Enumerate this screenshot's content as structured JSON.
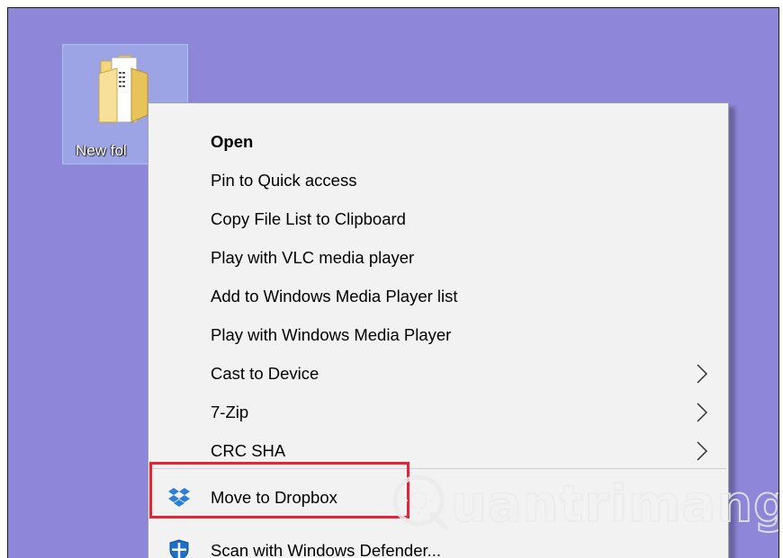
{
  "desktop": {
    "background_color": "#8e86d8",
    "folder": {
      "label": "New fol",
      "icon": "folder-icon"
    }
  },
  "context_menu": {
    "items": [
      {
        "label": "Open",
        "bold": true
      },
      {
        "label": "Pin to Quick access"
      },
      {
        "label": "Copy File List to Clipboard"
      },
      {
        "label": "Play with VLC media player"
      },
      {
        "label": "Add to Windows Media Player list"
      },
      {
        "label": "Play with Windows Media Player"
      },
      {
        "label": "Cast to Device",
        "submenu": true
      },
      {
        "label": "7-Zip",
        "submenu": true
      },
      {
        "label": "CRC SHA",
        "submenu": true
      },
      {
        "label": "Move to Dropbox",
        "icon": "dropbox-icon",
        "highlighted": true
      },
      {
        "label": "Scan with Windows Defender...",
        "icon": "windows-defender-icon"
      }
    ],
    "highlight_color": "#e2263a"
  },
  "watermark": {
    "text": "uantrimang",
    "logo": "quantrimang-logo"
  }
}
